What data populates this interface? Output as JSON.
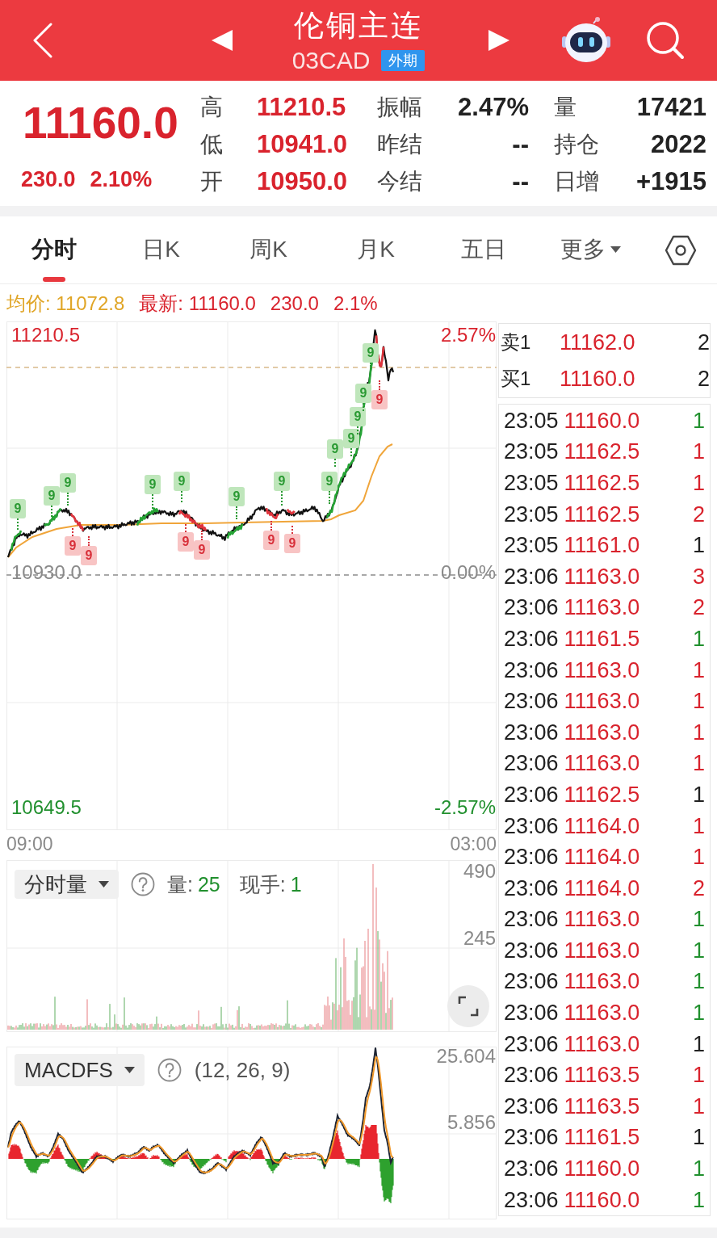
{
  "header": {
    "title": "伦铜主连",
    "code": "03CAD",
    "badge": "外期"
  },
  "quote": {
    "price": "11160.0",
    "change": "230.0",
    "change_pct": "2.10%",
    "stats": [
      {
        "label": "高",
        "value": "11210.5",
        "kind": "price"
      },
      {
        "label": "振幅",
        "value": "2.47%",
        "kind": "plain"
      },
      {
        "label": "量",
        "value": "17421",
        "kind": "plain"
      },
      {
        "label": "低",
        "value": "10941.0",
        "kind": "price"
      },
      {
        "label": "昨结",
        "value": "--",
        "kind": "plain"
      },
      {
        "label": "持仓",
        "value": "2022",
        "kind": "plain"
      },
      {
        "label": "开",
        "value": "10950.0",
        "kind": "price"
      },
      {
        "label": "今结",
        "value": "--",
        "kind": "plain"
      },
      {
        "label": "日增",
        "value": "+1915",
        "kind": "plain"
      }
    ]
  },
  "tabs": [
    {
      "label": "分时",
      "selected": true,
      "dropdown": false
    },
    {
      "label": "日K",
      "selected": false,
      "dropdown": false
    },
    {
      "label": "周K",
      "selected": false,
      "dropdown": false
    },
    {
      "label": "月K",
      "selected": false,
      "dropdown": false
    },
    {
      "label": "五日",
      "selected": false,
      "dropdown": false
    },
    {
      "label": "更多",
      "selected": false,
      "dropdown": true
    }
  ],
  "summary": [
    {
      "text": "均价: 11072.8",
      "kind": "average"
    },
    {
      "text": "最新: 11160.0",
      "kind": "latest"
    },
    {
      "text": "230.0",
      "kind": "latest"
    },
    {
      "text": "2.1%",
      "kind": "latest"
    }
  ],
  "price_chart": {
    "high_price": "11210.5",
    "high_pct": "2.57%",
    "base_price": "10930.0",
    "base_pct": "0.00%",
    "low_price": "10649.5",
    "low_pct": "-2.57%",
    "signals": [
      {
        "label": "9",
        "kind": "above"
      },
      {
        "label": "9",
        "kind": "above"
      },
      {
        "label": "9",
        "kind": "above"
      },
      {
        "label": "9",
        "kind": "below"
      },
      {
        "label": "9",
        "kind": "below"
      },
      {
        "label": "9",
        "kind": "above"
      },
      {
        "label": "9",
        "kind": "above"
      },
      {
        "label": "9",
        "kind": "below"
      },
      {
        "label": "9",
        "kind": "below"
      },
      {
        "label": "9",
        "kind": "above"
      },
      {
        "label": "9",
        "kind": "below"
      },
      {
        "label": "9",
        "kind": "above"
      },
      {
        "label": "9",
        "kind": "below"
      },
      {
        "label": "9",
        "kind": "above"
      },
      {
        "label": "9",
        "kind": "above"
      },
      {
        "label": "9",
        "kind": "above"
      },
      {
        "label": "9",
        "kind": "above"
      },
      {
        "label": "9",
        "kind": "above"
      },
      {
        "label": "9",
        "kind": "above"
      },
      {
        "label": "9",
        "kind": "below"
      }
    ]
  },
  "time_axis": {
    "start": "09:00",
    "end": "03:00"
  },
  "volume_panel": {
    "selector": "分时量",
    "stats": [
      {
        "label": "量:",
        "value": "25"
      },
      {
        "label": "现手:",
        "value": "1"
      }
    ],
    "top_label": "490",
    "mid_label": "245"
  },
  "macd_panel": {
    "selector": "MACDFS",
    "params": "(12, 26, 9)",
    "top_label": "25.604",
    "mid_label": "5.856"
  },
  "order_book": [
    {
      "label": "卖1",
      "price": "11162.0",
      "volume": "2"
    },
    {
      "label": "买1",
      "price": "11160.0",
      "volume": "2"
    }
  ],
  "trades": [
    {
      "time": "23:05",
      "price": "11160.0",
      "volume": "1",
      "color": "#21902e"
    },
    {
      "time": "23:05",
      "price": "11162.5",
      "volume": "1",
      "color": "#d9232d"
    },
    {
      "time": "23:05",
      "price": "11162.5",
      "volume": "1",
      "color": "#d9232d"
    },
    {
      "time": "23:05",
      "price": "11162.5",
      "volume": "2",
      "color": "#d9232d"
    },
    {
      "time": "23:05",
      "price": "11161.0",
      "volume": "1",
      "color": "#222222"
    },
    {
      "time": "23:06",
      "price": "11163.0",
      "volume": "3",
      "color": "#d9232d"
    },
    {
      "time": "23:06",
      "price": "11163.0",
      "volume": "2",
      "color": "#d9232d"
    },
    {
      "time": "23:06",
      "price": "11161.5",
      "volume": "1",
      "color": "#21902e"
    },
    {
      "time": "23:06",
      "price": "11163.0",
      "volume": "1",
      "color": "#d9232d"
    },
    {
      "time": "23:06",
      "price": "11163.0",
      "volume": "1",
      "color": "#d9232d"
    },
    {
      "time": "23:06",
      "price": "11163.0",
      "volume": "1",
      "color": "#d9232d"
    },
    {
      "time": "23:06",
      "price": "11163.0",
      "volume": "1",
      "color": "#d9232d"
    },
    {
      "time": "23:06",
      "price": "11162.5",
      "volume": "1",
      "color": "#222222"
    },
    {
      "time": "23:06",
      "price": "11164.0",
      "volume": "1",
      "color": "#d9232d"
    },
    {
      "time": "23:06",
      "price": "11164.0",
      "volume": "1",
      "color": "#d9232d"
    },
    {
      "time": "23:06",
      "price": "11164.0",
      "volume": "2",
      "color": "#d9232d"
    },
    {
      "time": "23:06",
      "price": "11163.0",
      "volume": "1",
      "color": "#21902e"
    },
    {
      "time": "23:06",
      "price": "11163.0",
      "volume": "1",
      "color": "#21902e"
    },
    {
      "time": "23:06",
      "price": "11163.0",
      "volume": "1",
      "color": "#21902e"
    },
    {
      "time": "23:06",
      "price": "11163.0",
      "volume": "1",
      "color": "#21902e"
    },
    {
      "time": "23:06",
      "price": "11163.0",
      "volume": "1",
      "color": "#222222"
    },
    {
      "time": "23:06",
      "price": "11163.5",
      "volume": "1",
      "color": "#d9232d"
    },
    {
      "time": "23:06",
      "price": "11163.5",
      "volume": "1",
      "color": "#d9232d"
    },
    {
      "time": "23:06",
      "price": "11161.5",
      "volume": "1",
      "color": "#222222"
    },
    {
      "time": "23:06",
      "price": "11160.0",
      "volume": "1",
      "color": "#21902e"
    },
    {
      "time": "23:06",
      "price": "11160.0",
      "volume": "1",
      "color": "#21902e"
    }
  ]
}
